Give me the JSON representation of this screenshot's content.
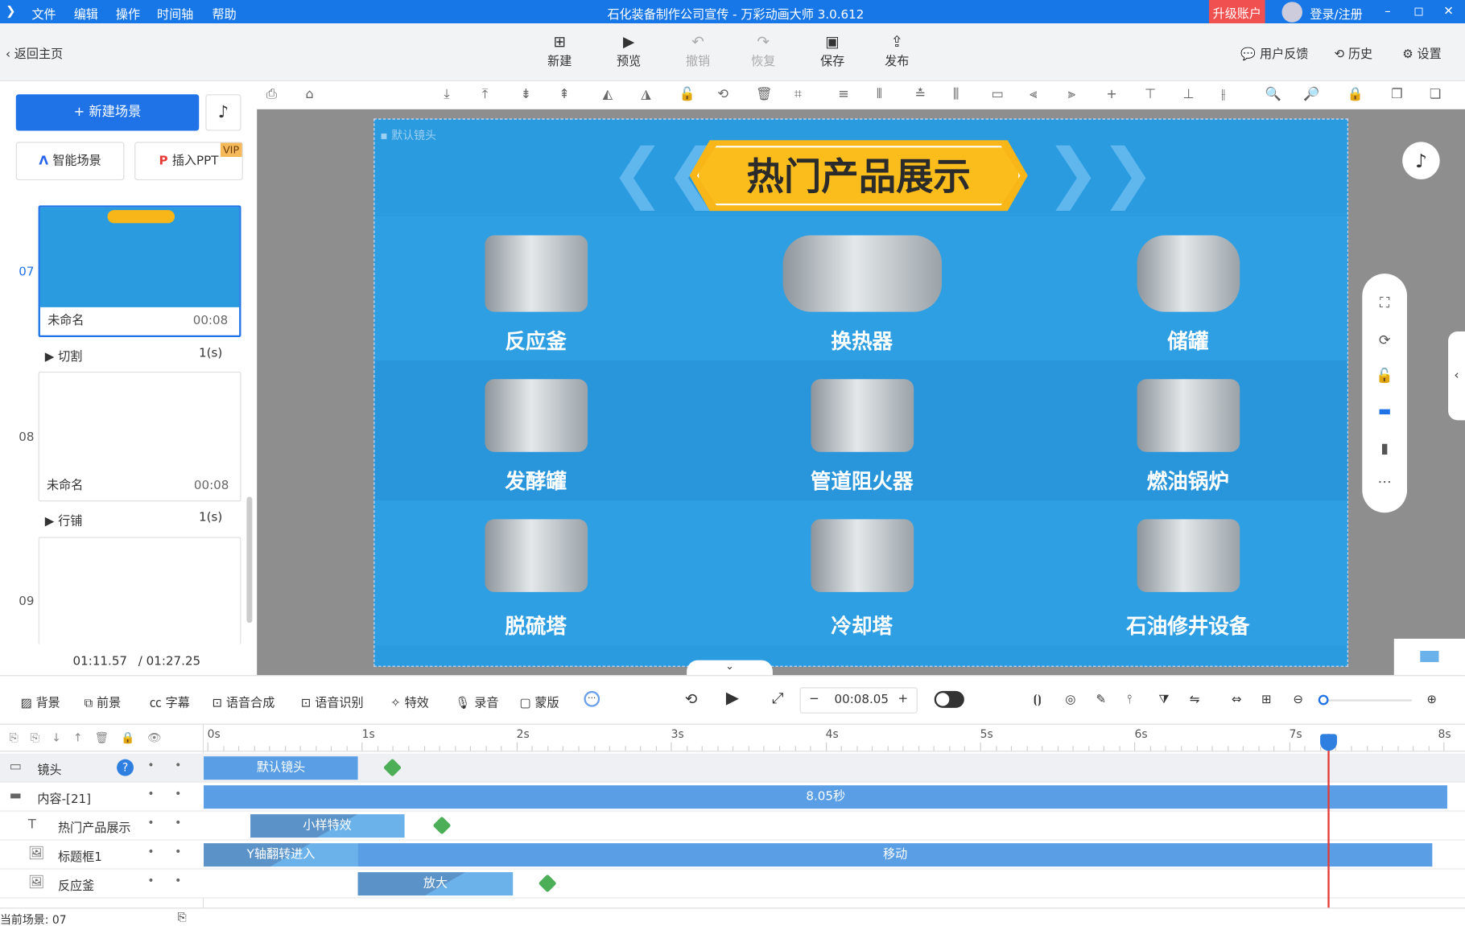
{
  "titlebar": {
    "menus": [
      "文件",
      "编辑",
      "操作",
      "时间轴",
      "帮助"
    ],
    "title": "石化装备制作公司宣传 - 万彩动画大师 3.0.612",
    "upgrade": "升级账户",
    "login": "登录/注册"
  },
  "toolbar": {
    "back": "返回主页",
    "new": "新建",
    "preview": "预览",
    "undo": "撤销",
    "redo": "恢复",
    "save": "保存",
    "publish": "发布",
    "feedback": "用户反馈",
    "history": "历史",
    "settings": "设置"
  },
  "left": {
    "new_scene": "+ 新建场景",
    "smart_scene": "智能场景",
    "insert_ppt": "插入PPT",
    "vip": "VIP",
    "scenes": [
      {
        "num": "07",
        "name": "未命名",
        "time": "00:08",
        "transition": "切割",
        "tdur": "1(s)"
      },
      {
        "num": "08",
        "name": "未命名",
        "time": "00:08",
        "transition": "行铺",
        "tdur": "1(s)"
      },
      {
        "num": "09"
      }
    ],
    "current_time": "01:11.57",
    "total_time": "/ 01:27.25"
  },
  "stage": {
    "camera_label": "默认镜头",
    "title": "热门产品展示",
    "items": [
      "反应釜",
      "换热器",
      "储罐",
      "发酵罐",
      "管道阻火器",
      "燃油锅炉",
      "脱硫塔",
      "冷却塔",
      "石油修井设备"
    ]
  },
  "bottombar": {
    "items": [
      "背景",
      "前景",
      "字幕",
      "语音合成",
      "语音识别",
      "特效",
      "录音",
      "蒙版"
    ],
    "time": "00:08.05"
  },
  "timeline": {
    "ticks": [
      "0s",
      "1s",
      "2s",
      "3s",
      "4s",
      "5s",
      "6s",
      "7s",
      "8s"
    ],
    "playhead_s": 7.25,
    "tracks": [
      {
        "label": "镜头",
        "bars": [
          {
            "text": "默认镜头",
            "start": 0,
            "end": 1
          }
        ],
        "add": 1.2
      },
      {
        "label": "内容-[21]",
        "bars": [
          {
            "text": "8.05秒",
            "start": 0,
            "end": 8.05
          }
        ]
      },
      {
        "label": "热门产品展示",
        "bars": [
          {
            "text": "小样特效",
            "start": 0.3,
            "end": 1.3,
            "fx": true
          }
        ],
        "add": 1.52
      },
      {
        "label": "标题框1",
        "bars": [
          {
            "text": "Y轴翻转进入",
            "start": 0,
            "end": 1,
            "fx": true
          },
          {
            "text": "移动",
            "start": 1,
            "end": 7.95
          }
        ]
      },
      {
        "label": "反应釜",
        "bars": [
          {
            "text": "放大",
            "start": 1,
            "end": 2,
            "fx": true
          }
        ],
        "add": 2.2
      }
    ]
  },
  "status": {
    "current_scene": "当前场景: 07"
  },
  "colors": {
    "accent": "#1877e6",
    "stage": "#2b9be0",
    "banner": "#f8b619",
    "playhead": "#e53935"
  }
}
